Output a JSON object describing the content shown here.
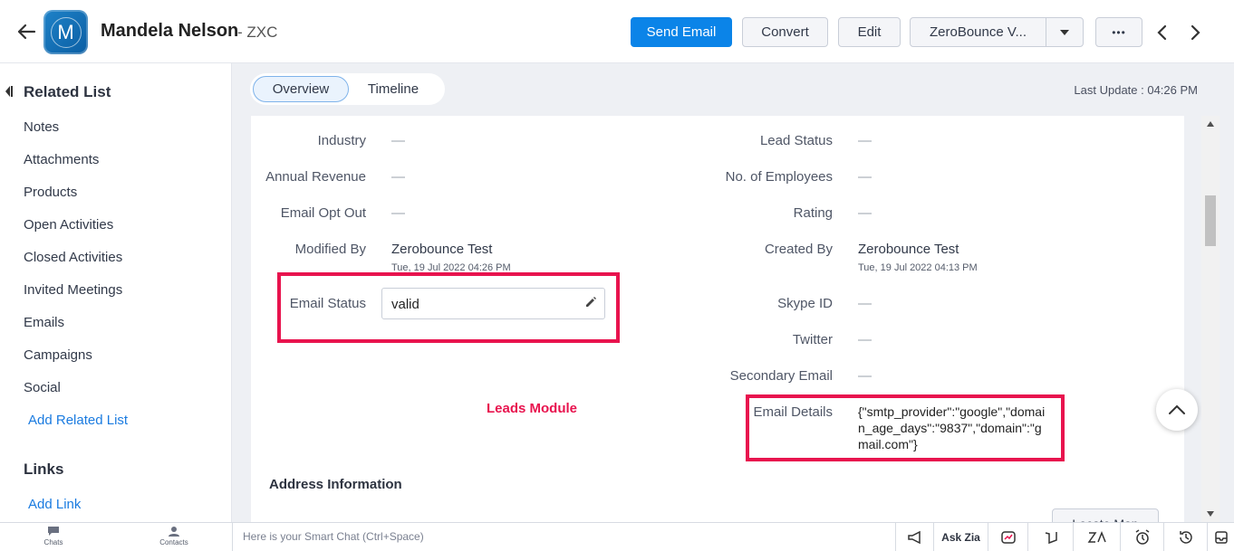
{
  "header": {
    "avatar_letter": "M",
    "record_name": "Mandela Nelson",
    "record_suffix": "- ZXC",
    "buttons": {
      "send_email": "Send Email",
      "convert": "Convert",
      "edit": "Edit",
      "zerobounce": "ZeroBounce V...",
      "more": "•••"
    }
  },
  "sidebar": {
    "related_heading": "Related List",
    "items": [
      "Notes",
      "Attachments",
      "Products",
      "Open Activities",
      "Closed Activities",
      "Invited Meetings",
      "Emails",
      "Campaigns",
      "Social"
    ],
    "add_related": "Add Related List",
    "links_heading": "Links",
    "add_link": "Add Link"
  },
  "tabs": {
    "overview": "Overview",
    "timeline": "Timeline"
  },
  "last_update": "Last Update : 04:26 PM",
  "fields_left": {
    "industry": {
      "label": "Industry",
      "value": "—"
    },
    "annual_revenue": {
      "label": "Annual Revenue",
      "value": "—"
    },
    "email_opt_out": {
      "label": "Email Opt Out",
      "value": "—"
    },
    "modified_by": {
      "label": "Modified By",
      "value": "Zerobounce Test",
      "sub": "Tue, 19 Jul 2022 04:26 PM"
    },
    "email_status": {
      "label": "Email Status",
      "value": "valid"
    }
  },
  "fields_right": {
    "lead_status": {
      "label": "Lead Status",
      "value": "—"
    },
    "no_employees": {
      "label": "No. of Employees",
      "value": "—"
    },
    "rating": {
      "label": "Rating",
      "value": "—"
    },
    "created_by": {
      "label": "Created By",
      "value": "Zerobounce Test",
      "sub": "Tue, 19 Jul 2022 04:13 PM"
    },
    "skype_id": {
      "label": "Skype ID",
      "value": "—"
    },
    "twitter": {
      "label": "Twitter",
      "value": "—"
    },
    "secondary_email": {
      "label": "Secondary Email",
      "value": "—"
    },
    "email_details": {
      "label": "Email Details",
      "value": "{\"smtp_provider\":\"google\",\"domain_age_days\":\"9837\",\"domain\":\"gmail.com\"}"
    }
  },
  "annotation": "Leads Module",
  "address_section": "Address Information",
  "locate_map": "Locate Map",
  "bottombar": {
    "chats": "Chats",
    "contacts": "Contacts",
    "smart_chat_placeholder": "Here is your Smart Chat (Ctrl+Space)",
    "ask_zia": "Ask Zia"
  },
  "colors": {
    "primary": "#0b84e8",
    "highlight": "#e8134e",
    "link": "#1a7be0"
  }
}
